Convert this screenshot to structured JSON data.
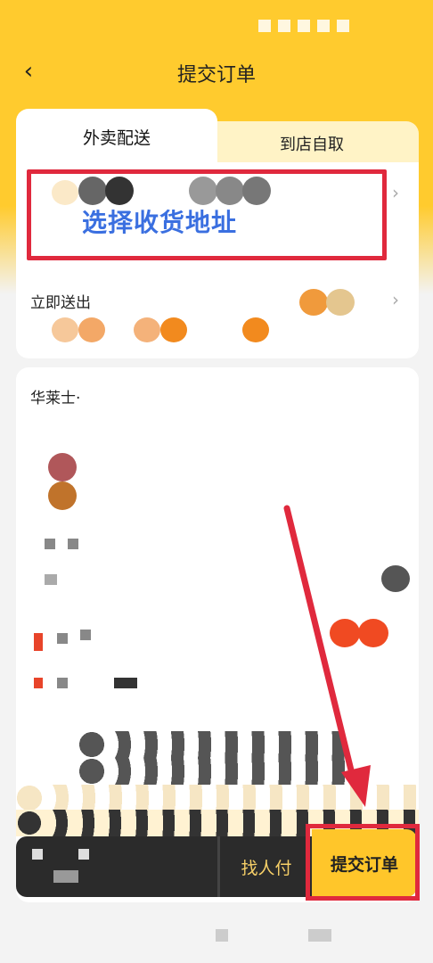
{
  "header": {
    "back_icon": "chevron-left-icon",
    "title": "提交订单"
  },
  "tabs": [
    {
      "label": "外卖配送",
      "active": true
    },
    {
      "label": "到店自取",
      "active": false
    }
  ],
  "address": {
    "label": "选择收货地址",
    "icon": "chevron-right-icon"
  },
  "delivery": {
    "label": "立即送出",
    "icon": "chevron-right-icon"
  },
  "store": {
    "name": "华莱士·"
  },
  "bottom_bar": {
    "pay_other_label": "找人付",
    "submit_label": "提交订单"
  },
  "colors": {
    "brand_yellow": "#ffcb2e",
    "highlight_red": "#e0293d",
    "address_blue": "#3a6fe0",
    "bar_dark": "#2b2b2b"
  }
}
